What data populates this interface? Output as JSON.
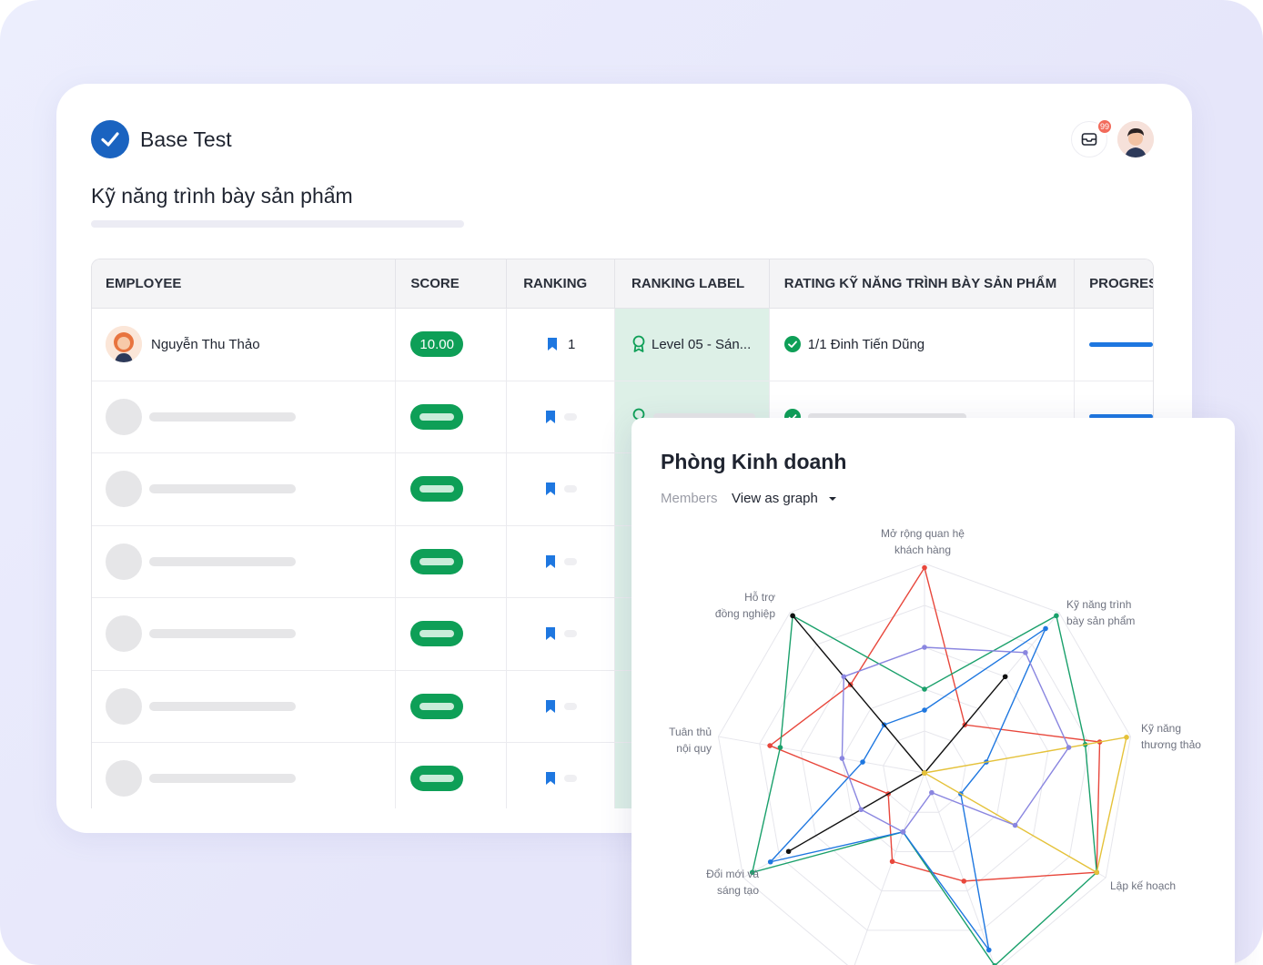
{
  "app": {
    "name": "Base Test",
    "notification_count": "99"
  },
  "page": {
    "title": "Kỹ năng trình bày sản phẩm"
  },
  "table": {
    "columns": [
      "EMPLOYEE",
      "SCORE",
      "RANKING",
      "RANKING LABEL",
      "RATING KỸ NĂNG TRÌNH BÀY SẢN PHẨM",
      "PROGRES"
    ],
    "first_row": {
      "employee": "Nguyễn Thu Thảo",
      "score": "10.00",
      "ranking": "1",
      "ranking_label": "Level 05 - Sán...",
      "rating": "1/1 Đinh Tiến Dũng"
    }
  },
  "graph": {
    "title": "Phòng Kinh doanh",
    "members_label": "Members",
    "view_select": "View as graph",
    "axes": [
      "Mở rộng quan hệ\nkhách hàng",
      "Kỹ năng trình\nbày sản phẩm",
      "Kỹ năng\nthương thảo",
      "Lập kế hoạch",
      "",
      "",
      "Đổi mới và\nsáng tạo",
      "Tuân thủ\nnội quy",
      "Hỗ trợ\nđồng nghiệp"
    ],
    "series_colors": [
      "#e8473c",
      "#1aa06b",
      "#1e77e0",
      "#111111",
      "#e5c23a",
      "#8a86e0",
      "#2a6fd6"
    ]
  }
}
